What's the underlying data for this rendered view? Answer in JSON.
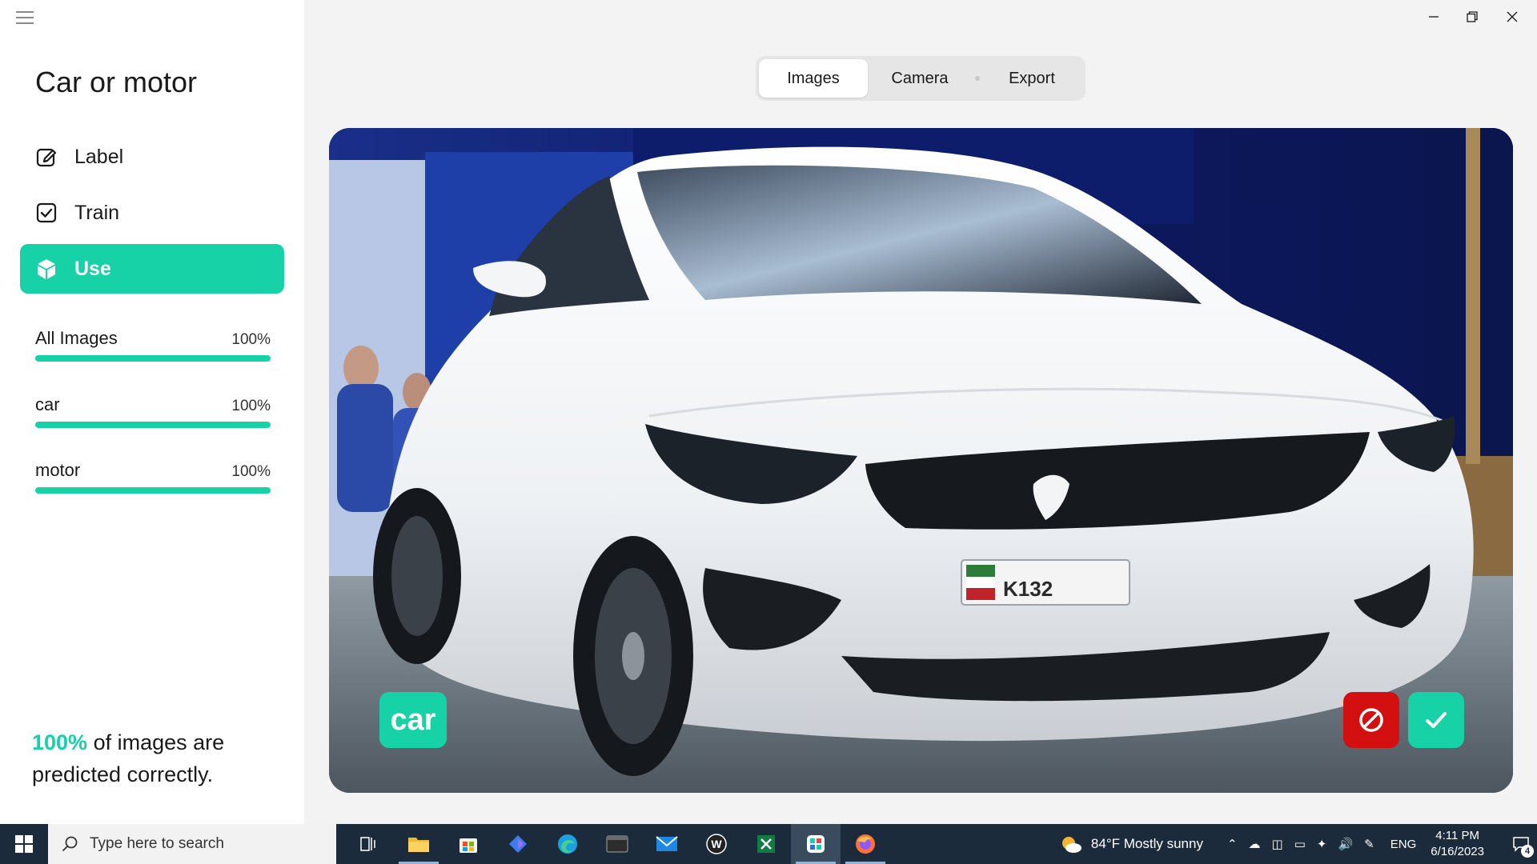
{
  "app": {
    "title": "Car or motor"
  },
  "nav": [
    {
      "label": "Label",
      "icon": "edit-icon",
      "active": false
    },
    {
      "label": "Train",
      "icon": "checkbox-icon",
      "active": false
    },
    {
      "label": "Use",
      "icon": "cube-icon",
      "active": true
    }
  ],
  "stats": [
    {
      "name": "All Images",
      "percent": "100%",
      "value": 1.0
    },
    {
      "name": "car",
      "percent": "100%",
      "value": 1.0
    },
    {
      "name": "motor",
      "percent": "100%",
      "value": 1.0
    }
  ],
  "summary": {
    "highlight": "100%",
    "text": " of images are predicted correctly."
  },
  "tabs": [
    {
      "label": "Images",
      "active": true
    },
    {
      "label": "Camera",
      "active": false
    },
    {
      "label": "Export",
      "active": false
    }
  ],
  "preview": {
    "prediction": "car",
    "plate_text": "K132"
  },
  "colors": {
    "accent": "#17d1a7",
    "reject": "#d40f0f",
    "taskbar": "#1c2b3c"
  },
  "taskbar": {
    "search_placeholder": "Type here to search",
    "apps": [
      "task-view-icon",
      "file-explorer-icon",
      "store-icon",
      "copilot-icon",
      "edge-icon",
      "terminal-icon",
      "mail-icon",
      "wps-icon",
      "excel-like-icon",
      "lobe-icon",
      "firefox-icon"
    ],
    "weather": "84°F  Mostly sunny",
    "language": "ENG",
    "time": "4:11 PM",
    "date": "6/16/2023",
    "notification_count": "4"
  }
}
